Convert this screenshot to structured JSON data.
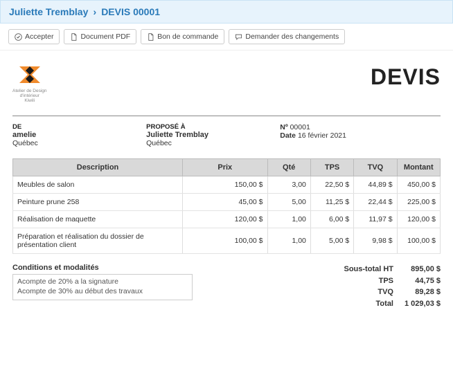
{
  "breadcrumb": {
    "customer": "Juliette Tremblay",
    "document": "DEVIS 00001"
  },
  "toolbar": {
    "accept": "Accepter",
    "pdf": "Document PDF",
    "po": "Bon de commande",
    "changes": "Demander des changements"
  },
  "logo": {
    "line1": "Atelier de Design",
    "line2": "d'intérieur",
    "line3": "Kiwili"
  },
  "doc_title": "DEVIS",
  "from": {
    "label": "DE",
    "name": "amelie",
    "city": "Québec"
  },
  "to": {
    "label": "PROPOSÉ À",
    "name": "Juliette Tremblay",
    "city": "Québec"
  },
  "meta": {
    "no_label": "Nº",
    "no_value": "00001",
    "date_label": "Date",
    "date_value": "16 février 2021"
  },
  "columns": {
    "desc": "Description",
    "price": "Prix",
    "qty": "Qté",
    "tps": "TPS",
    "tvq": "TVQ",
    "amount": "Montant"
  },
  "lines": [
    {
      "desc": "Meubles de salon",
      "price": "150,00 $",
      "qty": "3,00",
      "tps": "22,50 $",
      "tvq": "44,89 $",
      "amount": "450,00 $"
    },
    {
      "desc": "Peinture prune 258",
      "price": "45,00 $",
      "qty": "5,00",
      "tps": "11,25 $",
      "tvq": "22,44 $",
      "amount": "225,00 $"
    },
    {
      "desc": "Réalisation de maquette",
      "price": "120,00 $",
      "qty": "1,00",
      "tps": "6,00 $",
      "tvq": "11,97 $",
      "amount": "120,00 $"
    },
    {
      "desc": "Préparation et réalisation du dossier de présentation client",
      "price": "100,00 $",
      "qty": "1,00",
      "tps": "5,00 $",
      "tvq": "9,98 $",
      "amount": "100,00 $"
    }
  ],
  "terms": {
    "title": "Conditions et modalités",
    "line1": "Acompte de 20% a la signature",
    "line2": "Acompte de 30% au début des travaux"
  },
  "totals": {
    "subtotal_label": "Sous-total HT",
    "subtotal_value": "895,00 $",
    "tps_label": "TPS",
    "tps_value": "44,75 $",
    "tvq_label": "TVQ",
    "tvq_value": "89,28 $",
    "total_label": "Total",
    "total_value": "1 029,03 $"
  }
}
